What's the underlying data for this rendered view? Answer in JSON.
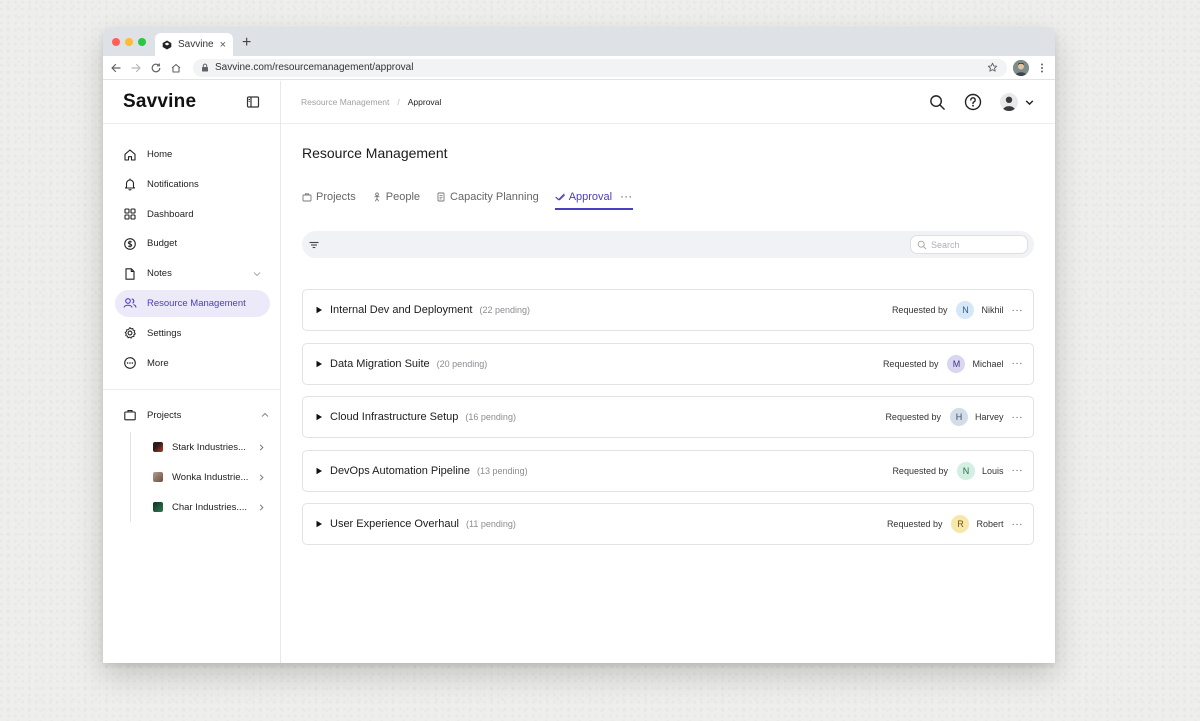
{
  "browser": {
    "tab_title": "Savvine",
    "tab_close": "×",
    "new_tab": "+",
    "url": "Savvine.com/resourcemanagement/approval"
  },
  "app": {
    "brand": "Savvine",
    "breadcrumb": [
      "Resource Management",
      "/",
      "Approval"
    ]
  },
  "sidebar": {
    "items": [
      {
        "label": "Home",
        "icon": "home-icon"
      },
      {
        "label": "Notifications",
        "icon": "bell-icon"
      },
      {
        "label": "Dashboard",
        "icon": "dashboard-icon"
      },
      {
        "label": "Budget",
        "icon": "dollar-icon"
      },
      {
        "label": "Notes",
        "icon": "file-icon"
      },
      {
        "label": "Resource Management",
        "icon": "users-icon",
        "active": true
      },
      {
        "label": "Settings",
        "icon": "gear-icon"
      },
      {
        "label": "More",
        "icon": "more-circle-icon"
      }
    ],
    "projects_label": "Projects",
    "projects": [
      {
        "name": "Stark Industries...",
        "color": "#c0392b"
      },
      {
        "name": "Wonka Industrie...",
        "color": "#8e6b5a"
      },
      {
        "name": "Char Industries....",
        "color": "#1e5a3a"
      }
    ]
  },
  "main": {
    "title": "Resource Management",
    "tabs": [
      {
        "label": "Projects",
        "icon": "briefcase-icon"
      },
      {
        "label": "People",
        "icon": "person-icon"
      },
      {
        "label": "Capacity Planning",
        "icon": "document-icon"
      },
      {
        "label": "Approval",
        "icon": "check-icon",
        "active": true
      }
    ],
    "tab_more": "···",
    "search_placeholder": "Search",
    "requested_by_label": "Requested by",
    "rows": [
      {
        "title": "Internal Dev and Deployment",
        "count": "(22 pending)",
        "initial": "N",
        "name": "Nikhil",
        "avatar_bg": "#d6e8f7",
        "avatar_fg": "#2f5f87"
      },
      {
        "title": "Data Migration Suite",
        "count": "(20 pending)",
        "initial": "M",
        "name": "Michael",
        "avatar_bg": "#d9d6f2",
        "avatar_fg": "#3f3680"
      },
      {
        "title": "Cloud Infrastructure Setup",
        "count": "(16 pending)",
        "initial": "H",
        "name": "Harvey",
        "avatar_bg": "#d3dde7",
        "avatar_fg": "#3a4c5e"
      },
      {
        "title": "DevOps Automation Pipeline",
        "count": "(13 pending)",
        "initial": "N",
        "name": "Louis",
        "avatar_bg": "#d3efe2",
        "avatar_fg": "#2b6a4b"
      },
      {
        "title": "User Experience Overhaul",
        "count": "(11 pending)",
        "initial": "R",
        "name": "Robert",
        "avatar_bg": "#f7e7a8",
        "avatar_fg": "#6b5414"
      }
    ],
    "row_more": "···"
  },
  "colors": {
    "accent": "#4a3fc0",
    "active_bg": "#eceaf8"
  }
}
